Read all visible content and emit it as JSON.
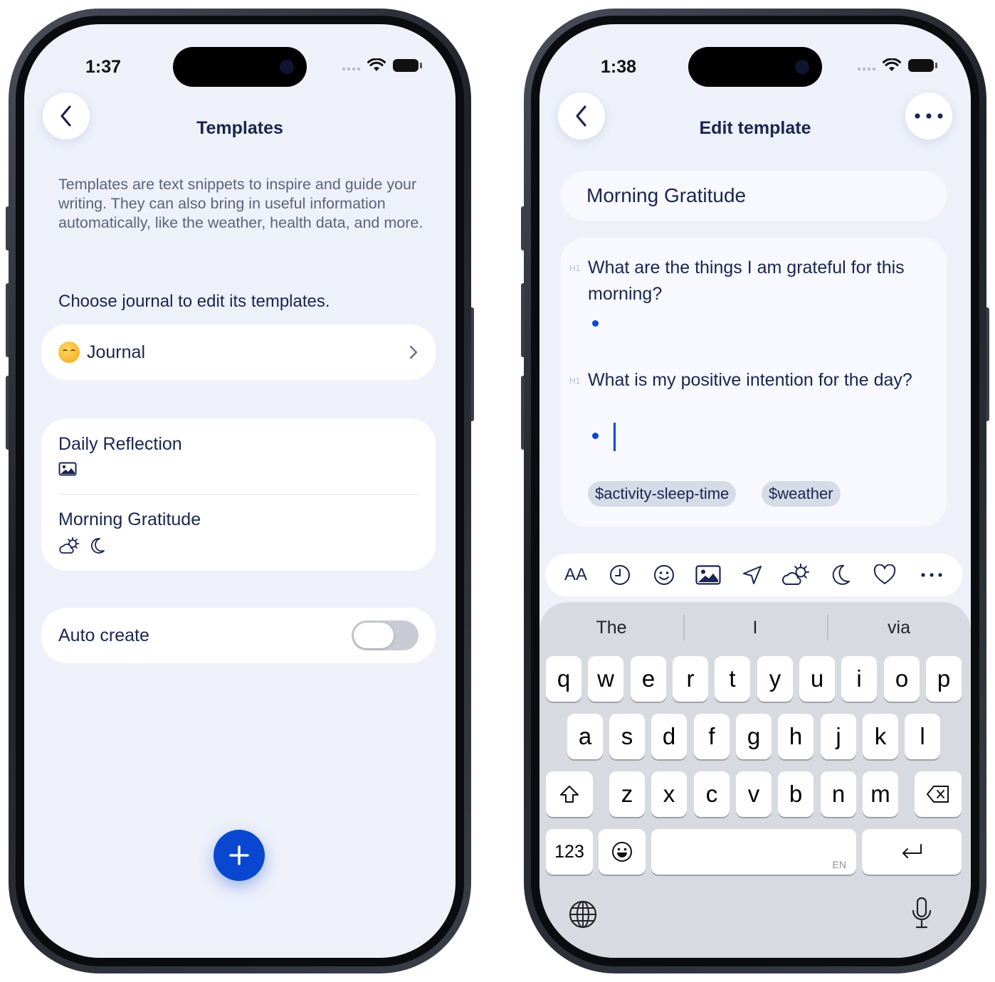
{
  "left": {
    "status_time": "1:37",
    "nav_title": "Templates",
    "intro": "Templates are text snippets to inspire and guide your writing. They can also bring in useful information automatically, like the weather, health data, and more.",
    "choose_label": "Choose journal to edit its templates.",
    "journal": {
      "icon": "smiling-face-emoji",
      "label": "Journal"
    },
    "templates": [
      {
        "name": "Daily Reflection",
        "icons": [
          "photo-icon"
        ]
      },
      {
        "name": "Morning Gratitude",
        "icons": [
          "weather-icon",
          "moon-icon"
        ]
      }
    ],
    "auto_create": {
      "label": "Auto create",
      "enabled": false
    },
    "fab_icon": "plus-icon",
    "accent": "#0a47d1"
  },
  "right": {
    "status_time": "1:38",
    "nav_title": "Edit template",
    "template_title": "Morning Gratitude",
    "heading_marker": "H1",
    "questions": [
      "What are the things I am grateful for this morning?",
      "What is my positive intention for the day?"
    ],
    "chips": [
      "$activity-sleep-time",
      "$weather"
    ],
    "toolbar": [
      "text-size",
      "clock",
      "emoji",
      "photo",
      "location",
      "weather",
      "moon",
      "heart",
      "more"
    ],
    "toolbar_text_size_label": "AA",
    "suggestions": [
      "The",
      "I",
      "via"
    ],
    "keyboard": {
      "row1": [
        "q",
        "w",
        "e",
        "r",
        "t",
        "y",
        "u",
        "i",
        "o",
        "p"
      ],
      "row2": [
        "a",
        "s",
        "d",
        "f",
        "g",
        "h",
        "j",
        "k",
        "l"
      ],
      "row3": [
        "z",
        "x",
        "c",
        "v",
        "b",
        "n",
        "m"
      ],
      "numbers_label": "123",
      "space_lang": "EN"
    }
  }
}
